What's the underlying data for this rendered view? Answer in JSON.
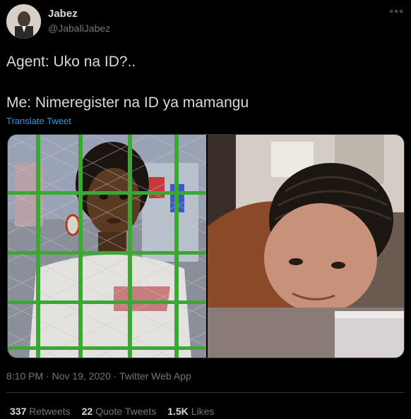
{
  "author": {
    "name": "Jabez",
    "handle": "@JabaliJabez"
  },
  "tweet": {
    "line1": "Agent: Uko na ID?..",
    "line2": "Me: Nimeregister na ID ya mamangu",
    "translate": "Translate Tweet"
  },
  "meta": {
    "timestamp": "8:10 PM · Nov 19, 2020 · Twitter Web App"
  },
  "stats": {
    "retweets_count": "337",
    "retweets_label": "Retweets",
    "quotes_count": "22",
    "quotes_label": "Quote Tweets",
    "likes_count": "1.5K",
    "likes_label": "Likes"
  },
  "colors": {
    "background": "#000000",
    "text": "#d9d9d9",
    "muted": "#6e767d",
    "link": "#1d9bf0",
    "fence": "#3aa832"
  }
}
